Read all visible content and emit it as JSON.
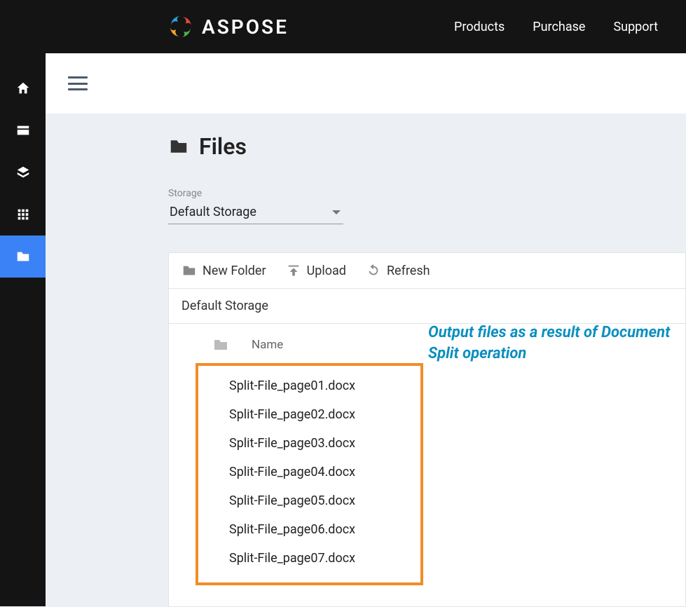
{
  "brand": {
    "name": "ASPOSE"
  },
  "topnav": [
    "Products",
    "Purchase",
    "Support"
  ],
  "sidebar": [
    {
      "icon": "home"
    },
    {
      "icon": "card"
    },
    {
      "icon": "layers"
    },
    {
      "icon": "grid"
    },
    {
      "icon": "folder",
      "active": true
    }
  ],
  "page": {
    "title": "Files"
  },
  "storage": {
    "label": "Storage",
    "value": "Default Storage"
  },
  "toolbar": {
    "newfolder": "New Folder",
    "upload": "Upload",
    "refresh": "Refresh"
  },
  "breadcrumb": "Default Storage",
  "columns": {
    "name": "Name"
  },
  "files": [
    "Split-File_page01.docx",
    "Split-File_page02.docx",
    "Split-File_page03.docx",
    "Split-File_page04.docx",
    "Split-File_page05.docx",
    "Split-File_page06.docx",
    "Split-File_page07.docx"
  ],
  "annotation": "Output files as a result of Document Split operation"
}
